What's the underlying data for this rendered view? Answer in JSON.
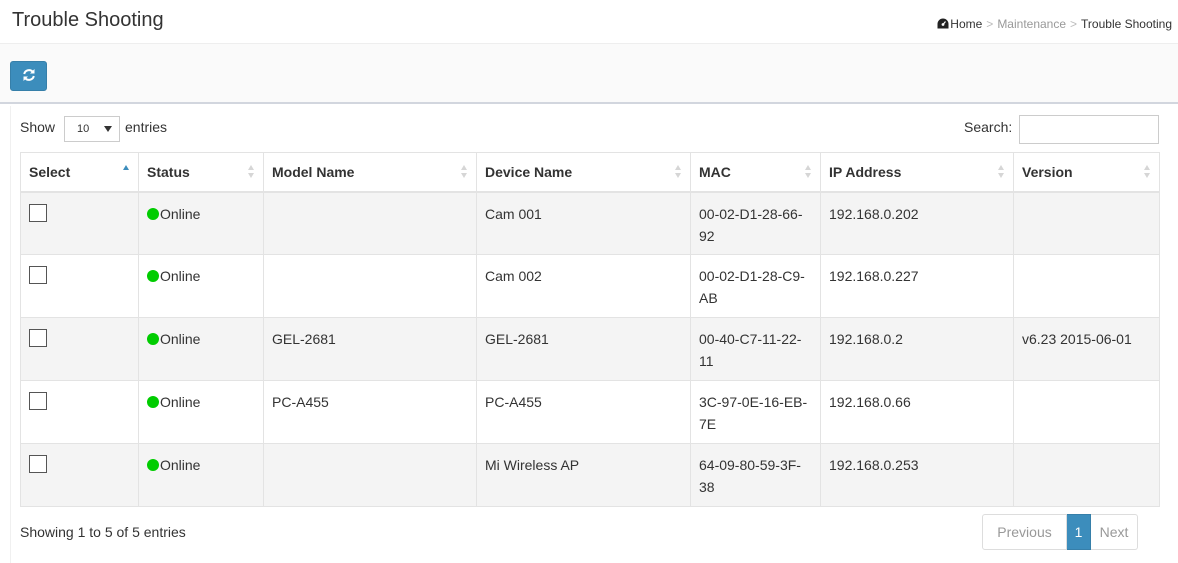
{
  "header": {
    "title": "Trouble Shooting",
    "breadcrumb": {
      "home": "Home",
      "middle": "Maintenance",
      "current": "Trouble Shooting",
      "separator": ">"
    }
  },
  "toolbar": {
    "refresh_icon": "refresh-icon"
  },
  "table_controls": {
    "show_label": "Show",
    "page_length": "10",
    "entries_label": "entries",
    "search_label": "Search:",
    "search_value": ""
  },
  "table": {
    "columns": [
      "Select",
      "Status",
      "Model Name",
      "Device Name",
      "MAC",
      "IP Address",
      "Version"
    ],
    "sorted_column": "Select",
    "rows": [
      {
        "selected": false,
        "status": "Online",
        "model": "",
        "device": "Cam 001",
        "mac": "00-02-D1-28-66-92",
        "ip": "192.168.0.202",
        "version": ""
      },
      {
        "selected": false,
        "status": "Online",
        "model": "",
        "device": "Cam 002",
        "mac": "00-02-D1-28-C9-AB",
        "ip": "192.168.0.227",
        "version": ""
      },
      {
        "selected": false,
        "status": "Online",
        "model": "GEL-2681",
        "device": "GEL-2681",
        "mac": "00-40-C7-11-22-11",
        "ip": "192.168.0.2",
        "version": "v6.23 2015-06-01"
      },
      {
        "selected": false,
        "status": "Online",
        "model": "PC-A455",
        "device": "PC-A455",
        "mac": "3C-97-0E-16-EB-7E",
        "ip": "192.168.0.66",
        "version": ""
      },
      {
        "selected": false,
        "status": "Online",
        "model": "",
        "device": "Mi Wireless AP",
        "mac": "64-09-80-59-3F-38",
        "ip": "192.168.0.253",
        "version": ""
      }
    ]
  },
  "footer": {
    "info": "Showing 1 to 5 of 5 entries",
    "previous": "Previous",
    "current_page": "1",
    "next": "Next"
  },
  "colors": {
    "accent": "#3c8dbc",
    "online": "#00cc00"
  }
}
